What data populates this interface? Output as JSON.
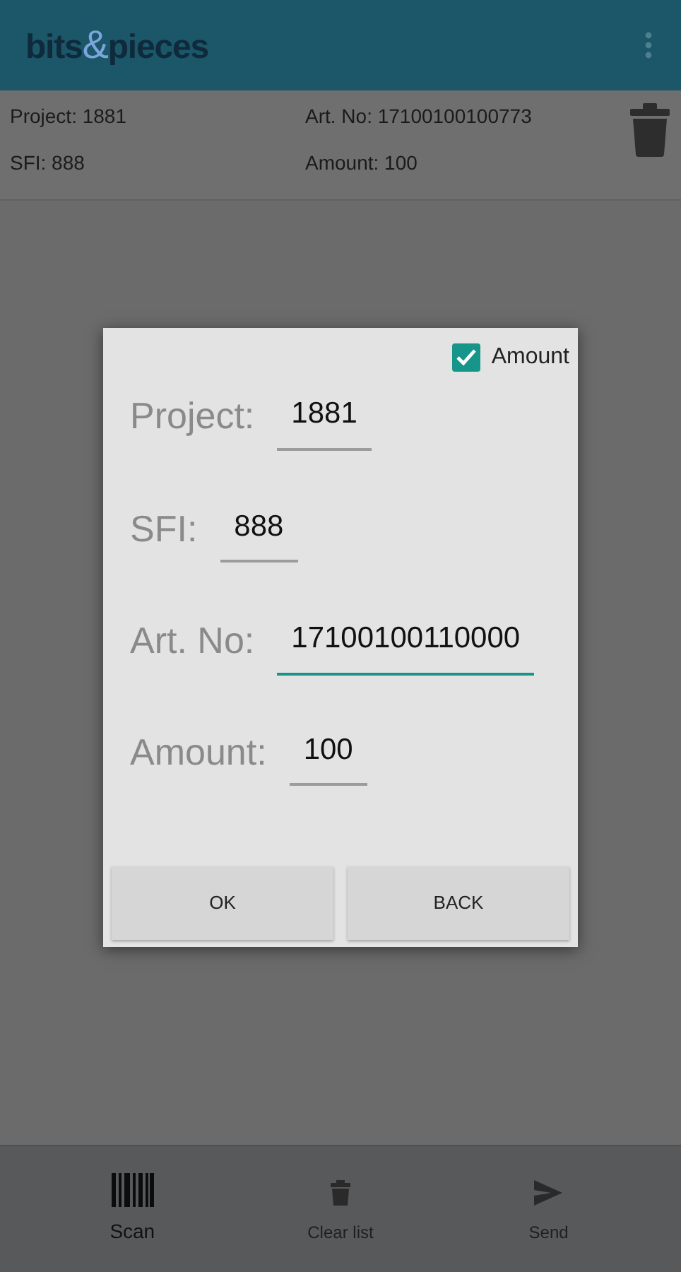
{
  "app_bar": {
    "logo": [
      "bits",
      "&",
      "pieces"
    ]
  },
  "summary": [
    {
      "label": "Project:",
      "value": "1881"
    },
    {
      "label": "Art. No:",
      "value": "17100100100773"
    },
    {
      "label": "SFI:",
      "value": "888"
    },
    {
      "label": "Amount:",
      "value": "100"
    }
  ],
  "dialog": {
    "amount_toggle": {
      "label": "Amount",
      "checked": true
    },
    "fields": [
      {
        "label": "Project:",
        "value": "1881",
        "focused": false
      },
      {
        "label": "SFI:",
        "value": "888",
        "focused": false
      },
      {
        "label": "Art. No:",
        "value": "17100100110000",
        "focused": true
      },
      {
        "label": "Amount:",
        "value": "100",
        "focused": false
      }
    ],
    "buttons": [
      "OK",
      "BACK"
    ]
  },
  "bottom_nav": [
    {
      "kind": "scan",
      "label": "Scan",
      "selected": true
    },
    {
      "kind": "clear",
      "label": "Clear list",
      "selected": false
    },
    {
      "kind": "send",
      "label": "Send",
      "selected": false
    }
  ]
}
